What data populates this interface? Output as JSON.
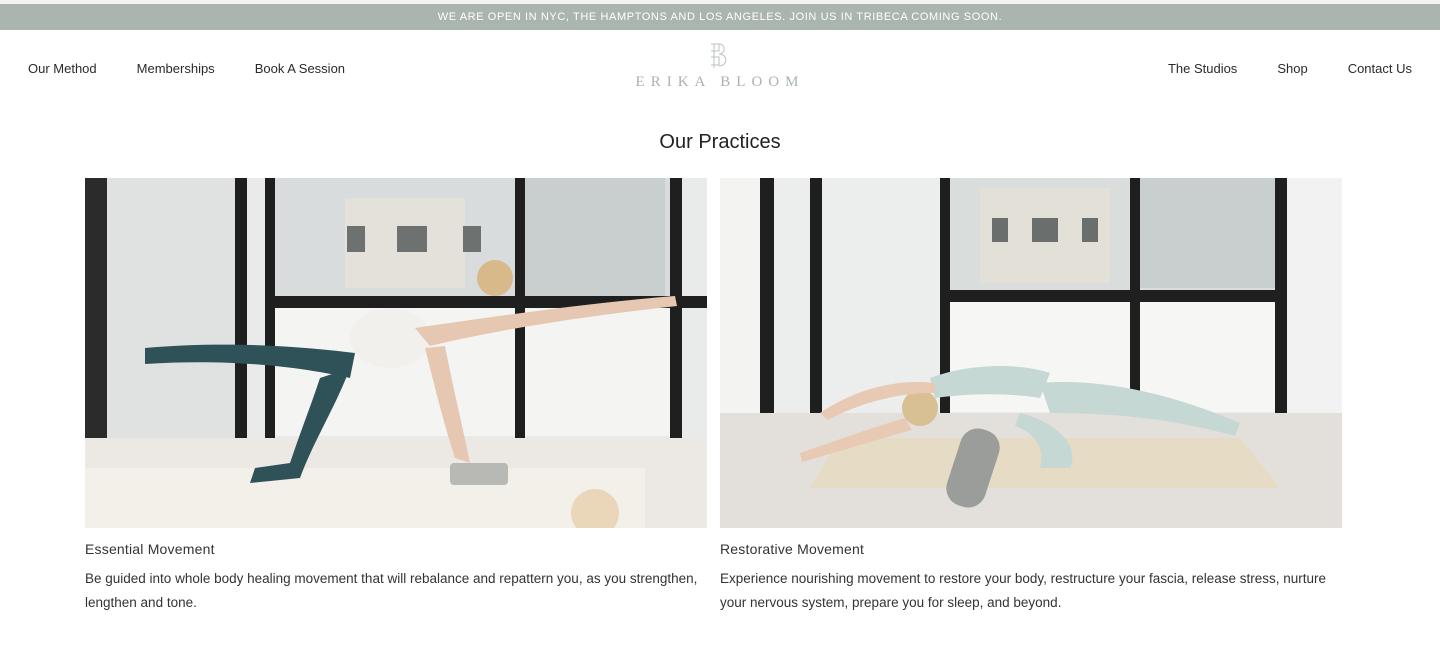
{
  "announcement": "WE ARE OPEN IN NYC, THE HAMPTONS AND LOS ANGELES. JOIN US IN TRIBECA COMING SOON.",
  "brand": {
    "name": "ERIKA BLOOM",
    "accent": "#aab5b0"
  },
  "nav": {
    "left": [
      "Our Method",
      "Memberships",
      "Book A Session"
    ],
    "right": [
      "The Studios",
      "Shop",
      "Contact Us"
    ]
  },
  "section": {
    "title": "Our Practices"
  },
  "practices": [
    {
      "title": "Essential Movement",
      "description": "Be guided into whole body healing movement that will rebalance and repattern you, as you strengthen, lengthen and tone."
    },
    {
      "title": "Restorative Movement",
      "description": "Experience nourishing movement to restore your body, restructure your fascia, release stress, nurture your nervous system, prepare you for sleep, and beyond."
    }
  ]
}
